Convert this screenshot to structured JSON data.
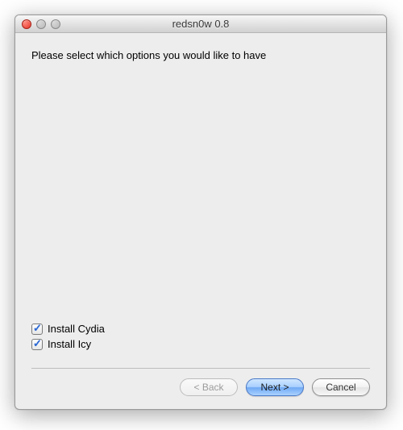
{
  "window": {
    "title": "redsn0w 0.8"
  },
  "content": {
    "prompt": "Please select which options you would like to have"
  },
  "options": [
    {
      "label": "Install Cydia",
      "checked": true
    },
    {
      "label": "Install Icy",
      "checked": true
    }
  ],
  "buttons": {
    "back": "< Back",
    "next": "Next >",
    "cancel": "Cancel"
  }
}
